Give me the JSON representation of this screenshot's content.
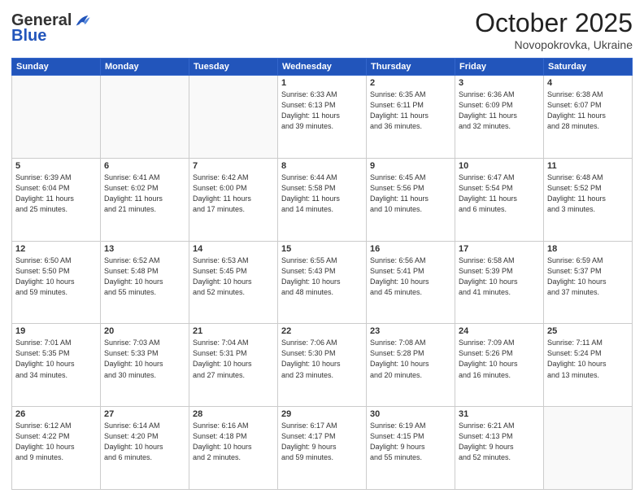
{
  "logo": {
    "general": "General",
    "blue": "Blue"
  },
  "title": "October 2025",
  "location": "Novopokrovka, Ukraine",
  "headers": [
    "Sunday",
    "Monday",
    "Tuesday",
    "Wednesday",
    "Thursday",
    "Friday",
    "Saturday"
  ],
  "weeks": [
    [
      {
        "num": "",
        "info": ""
      },
      {
        "num": "",
        "info": ""
      },
      {
        "num": "",
        "info": ""
      },
      {
        "num": "1",
        "info": "Sunrise: 6:33 AM\nSunset: 6:13 PM\nDaylight: 11 hours\nand 39 minutes."
      },
      {
        "num": "2",
        "info": "Sunrise: 6:35 AM\nSunset: 6:11 PM\nDaylight: 11 hours\nand 36 minutes."
      },
      {
        "num": "3",
        "info": "Sunrise: 6:36 AM\nSunset: 6:09 PM\nDaylight: 11 hours\nand 32 minutes."
      },
      {
        "num": "4",
        "info": "Sunrise: 6:38 AM\nSunset: 6:07 PM\nDaylight: 11 hours\nand 28 minutes."
      }
    ],
    [
      {
        "num": "5",
        "info": "Sunrise: 6:39 AM\nSunset: 6:04 PM\nDaylight: 11 hours\nand 25 minutes."
      },
      {
        "num": "6",
        "info": "Sunrise: 6:41 AM\nSunset: 6:02 PM\nDaylight: 11 hours\nand 21 minutes."
      },
      {
        "num": "7",
        "info": "Sunrise: 6:42 AM\nSunset: 6:00 PM\nDaylight: 11 hours\nand 17 minutes."
      },
      {
        "num": "8",
        "info": "Sunrise: 6:44 AM\nSunset: 5:58 PM\nDaylight: 11 hours\nand 14 minutes."
      },
      {
        "num": "9",
        "info": "Sunrise: 6:45 AM\nSunset: 5:56 PM\nDaylight: 11 hours\nand 10 minutes."
      },
      {
        "num": "10",
        "info": "Sunrise: 6:47 AM\nSunset: 5:54 PM\nDaylight: 11 hours\nand 6 minutes."
      },
      {
        "num": "11",
        "info": "Sunrise: 6:48 AM\nSunset: 5:52 PM\nDaylight: 11 hours\nand 3 minutes."
      }
    ],
    [
      {
        "num": "12",
        "info": "Sunrise: 6:50 AM\nSunset: 5:50 PM\nDaylight: 10 hours\nand 59 minutes."
      },
      {
        "num": "13",
        "info": "Sunrise: 6:52 AM\nSunset: 5:48 PM\nDaylight: 10 hours\nand 55 minutes."
      },
      {
        "num": "14",
        "info": "Sunrise: 6:53 AM\nSunset: 5:45 PM\nDaylight: 10 hours\nand 52 minutes."
      },
      {
        "num": "15",
        "info": "Sunrise: 6:55 AM\nSunset: 5:43 PM\nDaylight: 10 hours\nand 48 minutes."
      },
      {
        "num": "16",
        "info": "Sunrise: 6:56 AM\nSunset: 5:41 PM\nDaylight: 10 hours\nand 45 minutes."
      },
      {
        "num": "17",
        "info": "Sunrise: 6:58 AM\nSunset: 5:39 PM\nDaylight: 10 hours\nand 41 minutes."
      },
      {
        "num": "18",
        "info": "Sunrise: 6:59 AM\nSunset: 5:37 PM\nDaylight: 10 hours\nand 37 minutes."
      }
    ],
    [
      {
        "num": "19",
        "info": "Sunrise: 7:01 AM\nSunset: 5:35 PM\nDaylight: 10 hours\nand 34 minutes."
      },
      {
        "num": "20",
        "info": "Sunrise: 7:03 AM\nSunset: 5:33 PM\nDaylight: 10 hours\nand 30 minutes."
      },
      {
        "num": "21",
        "info": "Sunrise: 7:04 AM\nSunset: 5:31 PM\nDaylight: 10 hours\nand 27 minutes."
      },
      {
        "num": "22",
        "info": "Sunrise: 7:06 AM\nSunset: 5:30 PM\nDaylight: 10 hours\nand 23 minutes."
      },
      {
        "num": "23",
        "info": "Sunrise: 7:08 AM\nSunset: 5:28 PM\nDaylight: 10 hours\nand 20 minutes."
      },
      {
        "num": "24",
        "info": "Sunrise: 7:09 AM\nSunset: 5:26 PM\nDaylight: 10 hours\nand 16 minutes."
      },
      {
        "num": "25",
        "info": "Sunrise: 7:11 AM\nSunset: 5:24 PM\nDaylight: 10 hours\nand 13 minutes."
      }
    ],
    [
      {
        "num": "26",
        "info": "Sunrise: 6:12 AM\nSunset: 4:22 PM\nDaylight: 10 hours\nand 9 minutes."
      },
      {
        "num": "27",
        "info": "Sunrise: 6:14 AM\nSunset: 4:20 PM\nDaylight: 10 hours\nand 6 minutes."
      },
      {
        "num": "28",
        "info": "Sunrise: 6:16 AM\nSunset: 4:18 PM\nDaylight: 10 hours\nand 2 minutes."
      },
      {
        "num": "29",
        "info": "Sunrise: 6:17 AM\nSunset: 4:17 PM\nDaylight: 9 hours\nand 59 minutes."
      },
      {
        "num": "30",
        "info": "Sunrise: 6:19 AM\nSunset: 4:15 PM\nDaylight: 9 hours\nand 55 minutes."
      },
      {
        "num": "31",
        "info": "Sunrise: 6:21 AM\nSunset: 4:13 PM\nDaylight: 9 hours\nand 52 minutes."
      },
      {
        "num": "",
        "info": ""
      }
    ]
  ]
}
